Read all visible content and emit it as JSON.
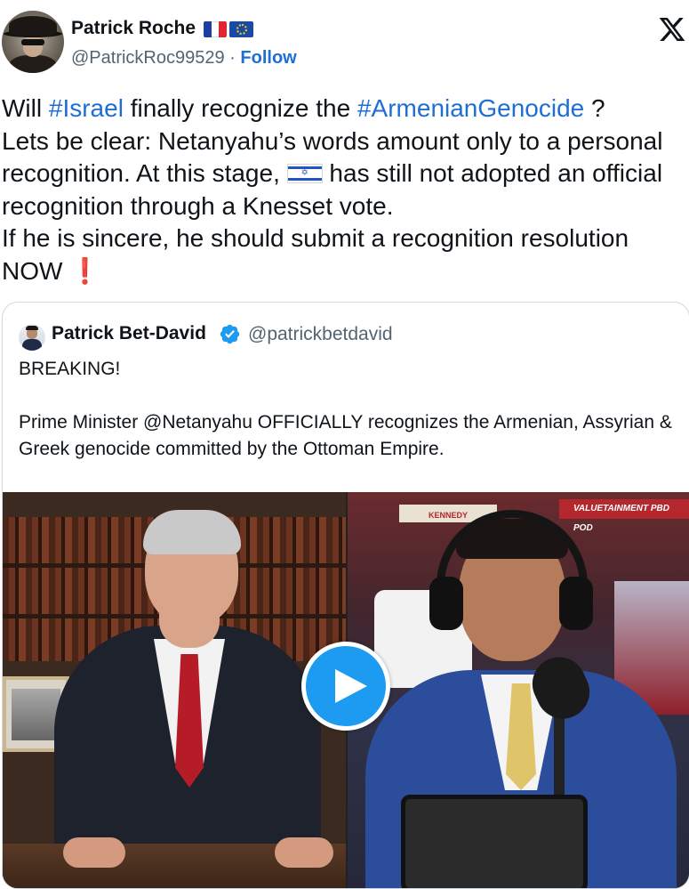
{
  "author": {
    "name": "Patrick Roche",
    "handle": "@PatrickRoc99529",
    "separator": " · ",
    "follow_label": "Follow",
    "flags": [
      "france-flag-icon",
      "eu-flag-icon"
    ]
  },
  "brand": {
    "logo": "x-logo-icon"
  },
  "tweet": {
    "t1": "Will ",
    "hashtag1": "#Israel",
    "t2": " finally recognize the ",
    "hashtag2": "#ArmenianGenocide",
    "t3": " ?\nLets be clear: Netanyahu’s words amount only to a personal recognition. At this stage, ",
    "flag_icon": "israel-flag-icon",
    "t4": " has still not adopted an official recognition through a Knesset vote.\nIf he is sincere, he should submit a recognition resolution NOW ",
    "exclaim": "❗"
  },
  "quote": {
    "name": "Patrick Bet-David",
    "handle": "@patrickbetdavid",
    "verified_icon": "verified-badge-icon",
    "line1": "BREAKING!",
    "line2": "Prime Minister @Netanyahu OFFICIALLY recognizes the Armenian, Assyrian & Greek genocide committed by the Ottoman Empire."
  },
  "media": {
    "banner_text": "VALUETAINMENT   PBD POD",
    "kennedy_text": "KENNEDY",
    "play_icon": "play-icon"
  },
  "colors": {
    "link_blue": "#1d6fd6",
    "play_button": "#1d9bf0",
    "verified": "#1d9bf0",
    "text_primary": "#0f1419",
    "text_secondary": "#536471",
    "border": "#cfd9de"
  }
}
